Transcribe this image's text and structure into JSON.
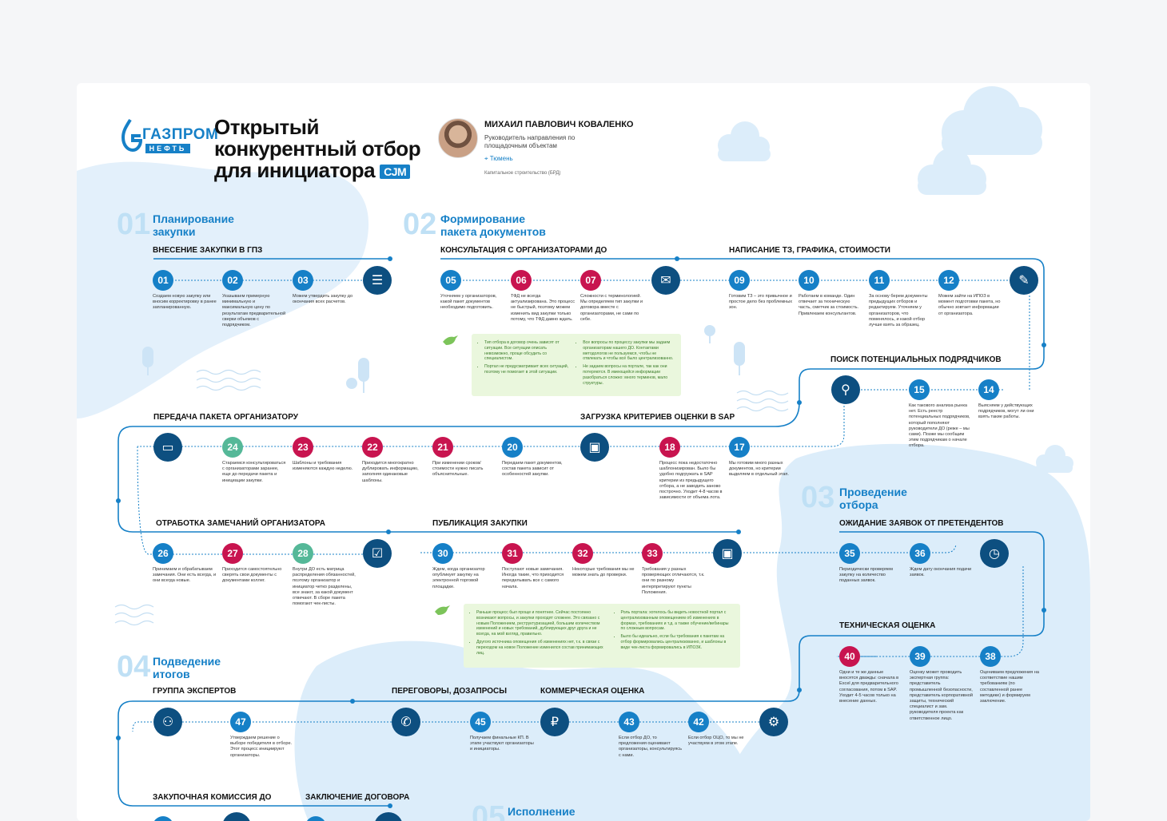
{
  "header": {
    "logo_brand": "ГАЗПРОМ",
    "logo_sub": "НЕФТЬ",
    "title_lines": [
      "Открытый",
      "конкурентный отбор",
      "для инициатора"
    ],
    "badge": "СЈМ"
  },
  "person": {
    "name": "МИХАИЛ ПАВЛОВИЧ КОВАЛЕНКО",
    "role": "Руководитель направления по площадочным объектам",
    "city": "Тюмень",
    "dept": "Капитальное строительство (БРД)"
  },
  "sections": [
    {
      "num": "01",
      "title": [
        "Планирование",
        "закупки"
      ]
    },
    {
      "num": "02",
      "title": [
        "Формирование",
        "пакета документов"
      ]
    },
    {
      "num": "03",
      "title": [
        "Проведение",
        "отбора"
      ]
    },
    {
      "num": "04",
      "title": [
        "Подведение",
        "итогов"
      ]
    },
    {
      "num": "05",
      "title": [
        "Исполнение"
      ]
    }
  ],
  "subheaders": {
    "gpz": "ВНЕСЕНИЕ ЗАКУПКИ В ГПЗ",
    "consult": "КОНСУЛЬТАЦИЯ С ОРГАНИЗАТОРАМИ ДО",
    "tz": "НАПИСАНИЕ ТЗ, ГРАФИКА, СТОИМОСТИ",
    "search": "ПОИСК ПОТЕНЦИАЛЬНЫХ ПОДРЯДЧИКОВ",
    "transfer": "ПЕРЕДАЧА ПАКЕТА ОРГАНИЗАТОРУ",
    "sap": "ЗАГРУЗКА КРИТЕРИЕВ ОЦЕНКИ В SAP",
    "remarks": "ОТРАБОТКА ЗАМЕЧАНИЙ ОРГАНИЗАТОРА",
    "publication": "ПУБЛИКАЦИЯ ЗАКУПКИ",
    "waiting": "ОЖИДАНИЕ ЗАЯВОК ОТ ПРЕТЕНДЕНТОВ",
    "tech": "ТЕХНИЧЕСКАЯ ОЦЕНКА",
    "experts": "ГРУППА ЭКСПЕРТОВ",
    "negotiation": "ПЕРЕГОВОРЫ, ДОЗАПРОСЫ",
    "commercial": "КОММЕРЧЕСКАЯ ОЦЕНКА",
    "commission": "ЗАКУПОЧНАЯ КОМИССИЯ ДО",
    "contract": "ЗАКЛЮЧЕНИЕ ДОГОВОРА"
  },
  "steps": {
    "s01": {
      "n": "01",
      "text": "Создаем новую закупку или вносим корректировку в ранее запланированную."
    },
    "s02": {
      "n": "02",
      "text": "Указываем примерную минимальную и максимальную цену по результатам предварительной сверки объемов с подрядчиком."
    },
    "s03": {
      "n": "03",
      "text": "Можем утвердить закупку до окончания всех расчетов."
    },
    "s05": {
      "n": "05",
      "text": "Уточняем у организаторов, какой пакет документов необходимо подготовить."
    },
    "s06": {
      "n": "06",
      "text": "ТФД не всегда актуализирована. Это процесс не быстрый, поэтому можем изменить вид закупки только потому, что ТФД давно ждать."
    },
    "s07": {
      "n": "07",
      "text": "Сложности с терминологией. Мы определяем тип закупки и договора вместе с организаторами, не сами по себе."
    },
    "s09": {
      "n": "09",
      "text": "Готовим ТЗ – это привычное и простое дело без проблемных зон."
    },
    "s10": {
      "n": "10",
      "text": "Работаем в команде. Один отвечает за техническую часть, сметчик за стоимость. Привлекаем консультантов."
    },
    "s11": {
      "n": "11",
      "text": "За основу берем документы предыдущих отборов и редактируем. Уточняем у организаторов, что поменялось, и какой отбор лучше взять за образец."
    },
    "s12": {
      "n": "12",
      "text": "Можем зайти на ИПОЗ в момент подготовки пакета, но обычно зовтает информации от организатора."
    },
    "s14": {
      "n": "14",
      "text": "Выясняем у действующих подрядчиков, могут ли они взять такие работы."
    },
    "s15": {
      "n": "15",
      "text": "Как такового анализа рынка нет. Есть реестр потенциальных подрядчиков, который пополняют руководители ДО (реже – мы сами). Позже мы сообщим этим подрядчикам о начале отбора."
    },
    "s17": {
      "n": "17",
      "text": "Мы готовим много разных документов, но критерии выделяем в отдельный этап."
    },
    "s18": {
      "n": "18",
      "text": "Процесс пока недостаточно шаблонизирован. Было бы удобно подгружать в SAP критерии из предыдущего отбора, а не заводить заново построчно. Уходит 4-8 часов в зависимости от объема лота."
    },
    "s20": {
      "n": "20",
      "text": "Передаем пакет документов, состав пакета зависит от особенностей закупки."
    },
    "s21": {
      "n": "21",
      "text": "При изменении сроков/ стоимости нужно писать объяснительные."
    },
    "s22": {
      "n": "22",
      "text": "Приходится многократно дублировать информацию, заполняя одинаковые шаблоны."
    },
    "s23": {
      "n": "23",
      "text": "Шаблоны и требования изменяются каждую неделю."
    },
    "s24": {
      "n": "24",
      "text": "Стараемся консультироваться с организаторами заранее, еще до передачи пакета и инициации закупки."
    },
    "s26": {
      "n": "26",
      "text": "Принимаем и обрабатываем замечания. Они есть всегда, и они всегда новые."
    },
    "s27": {
      "n": "27",
      "text": "Приходится самостоятельно сверять свои документы с документами коллег."
    },
    "s28": {
      "n": "28",
      "text": "Внутри ДО есть матрица распределения обязанностей, поэтому организатор и инициатор четко разделены, все знают, за какой документ отвечают. В сборе пакета помогают чек-листы."
    },
    "s30": {
      "n": "30",
      "text": "Ждем, когда организатор опубликует закупку на электронной торговой площадке."
    },
    "s31": {
      "n": "31",
      "text": "Поступают новые замечания. Иногда такие, что приходится переделывать все с самого начала."
    },
    "s32": {
      "n": "32",
      "text": "Некоторые требования мы не можем знать до проверки."
    },
    "s33": {
      "n": "33",
      "text": "Требования у разных проверяющих отличаются, т.к. они по разному интерпретируют пункты Положения."
    },
    "s35": {
      "n": "35",
      "text": "Периодически проверяем закупку на количество поданных заявок."
    },
    "s36": {
      "n": "36",
      "text": "Ждем дату окончания подачи заявок."
    },
    "s38": {
      "n": "38",
      "text": "Оцениваем предложения на соответствие нашим требованиям (по составленной ранее методике) и формируем заключение."
    },
    "s39": {
      "n": "39",
      "text": "Оценку может проводить экспертная группа: представитель промышленной безопасности, представитель корпоративной защиты, технический специалист и зам. руководителя проекта как ответственное лицо."
    },
    "s40": {
      "n": "40",
      "text": "Одни и те же данные вносятся дважды: сначала в Excel для предварительного согласования, потом в SAP. Уходит 4-5 часов только на внесение данных."
    },
    "s42": {
      "n": "42",
      "text": "Если отбор ОЦО, то мы не участвуем в этом этапе."
    },
    "s43": {
      "n": "43",
      "text": "Если отбор ДО, то предложения оценивают организаторы, консультируясь с нами."
    },
    "s45": {
      "n": "45",
      "text": "Получаем финальные КП. В этапе участвуют организаторы и инициаторы."
    },
    "s47": {
      "n": "47",
      "text": "Утверждаем решение о выборе победителя в отборе. Этот процесс инициируют организаторы."
    }
  },
  "notes": {
    "n1_left": [
      "Тип отбора в договор очень зависят от ситуации. Все ситуации описать невозможно, проще обсудить со специалистом.",
      "Портал не предусматривает всех ситуаций, поэтому не помогает в этой ситуации."
    ],
    "n1_right": [
      "Все вопросы по процессу закупки мы задаем организаторам нашего ДО. Контактами методологов не пользуемся, чтобы не отвлекать и чтобы всё было централизованно.",
      "Не задаем вопросы на портале, так как они потеряются. В имеющейся информации разобраться сложно: много терминов, мало структуры."
    ],
    "n2_left": [
      "Раньше процесс был проще и понятнее. Сейчас постоянно возникают вопросы, и закупки проходят сложнее. Это связано с новым Положением, реструктуризацией, большим количеством изменений и новых требований, дублирующих друг друга и не всегда, на мой взгляд, правильно.",
      "Другого источника оповещения об изменениях нет, т.к. в связи с переходом на новое Положение изменился состав принимающих лиц."
    ],
    "n2_right": [
      "Роль портала: хотелось бы видеть новостной портал с централизованным оповещением об изменениях в формах, требованиях и т.д. а также обучение/вебинары по сложным вопросам.",
      "Было бы идеально, если бы требования к пакетам на отбор формировались централизованно, и шаблоны в виде чек-листа формировались в ИПОЗК."
    ]
  },
  "colors": {
    "accent": "#1680c7",
    "dark": "#0d4f80",
    "red": "#c8144f",
    "green": "#55b898",
    "blob": "#dcedfa",
    "note": "#eaf7dd"
  },
  "icons": [
    "document-icon",
    "chat-icon",
    "pen-icon",
    "user-search-icon",
    "folder-send-icon",
    "browser-icon",
    "checklist-icon",
    "browser-check-icon",
    "clock-icon",
    "gear-icon",
    "ruble-icon",
    "chat-user-icon",
    "users-icon"
  ]
}
